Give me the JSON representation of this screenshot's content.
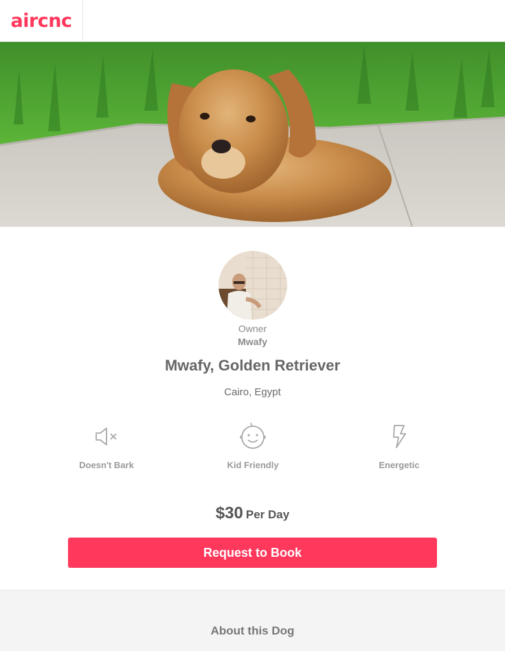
{
  "header": {
    "logo_text": "aircnc"
  },
  "hero": {
    "image": "golden-retriever-photo"
  },
  "owner": {
    "label": "Owner",
    "name": "Mwafy",
    "avatar": "owner-avatar-photo"
  },
  "dog": {
    "title": "Mwafy, Golden Retriever",
    "location": "Cairo, Egypt"
  },
  "traits": [
    {
      "icon": "muted-speaker-icon",
      "label": "Doesn't Bark"
    },
    {
      "icon": "smiley-baby-icon",
      "label": "Kid Friendly"
    },
    {
      "icon": "lightning-icon",
      "label": "Energetic"
    }
  ],
  "pricing": {
    "amount": "$30",
    "unit": "Per Day"
  },
  "actions": {
    "book_label": "Request to Book"
  },
  "about": {
    "title": "About this Dog"
  },
  "colors": {
    "brand": "#ff385c",
    "text": "#484848",
    "muted": "#9a9a9a"
  }
}
